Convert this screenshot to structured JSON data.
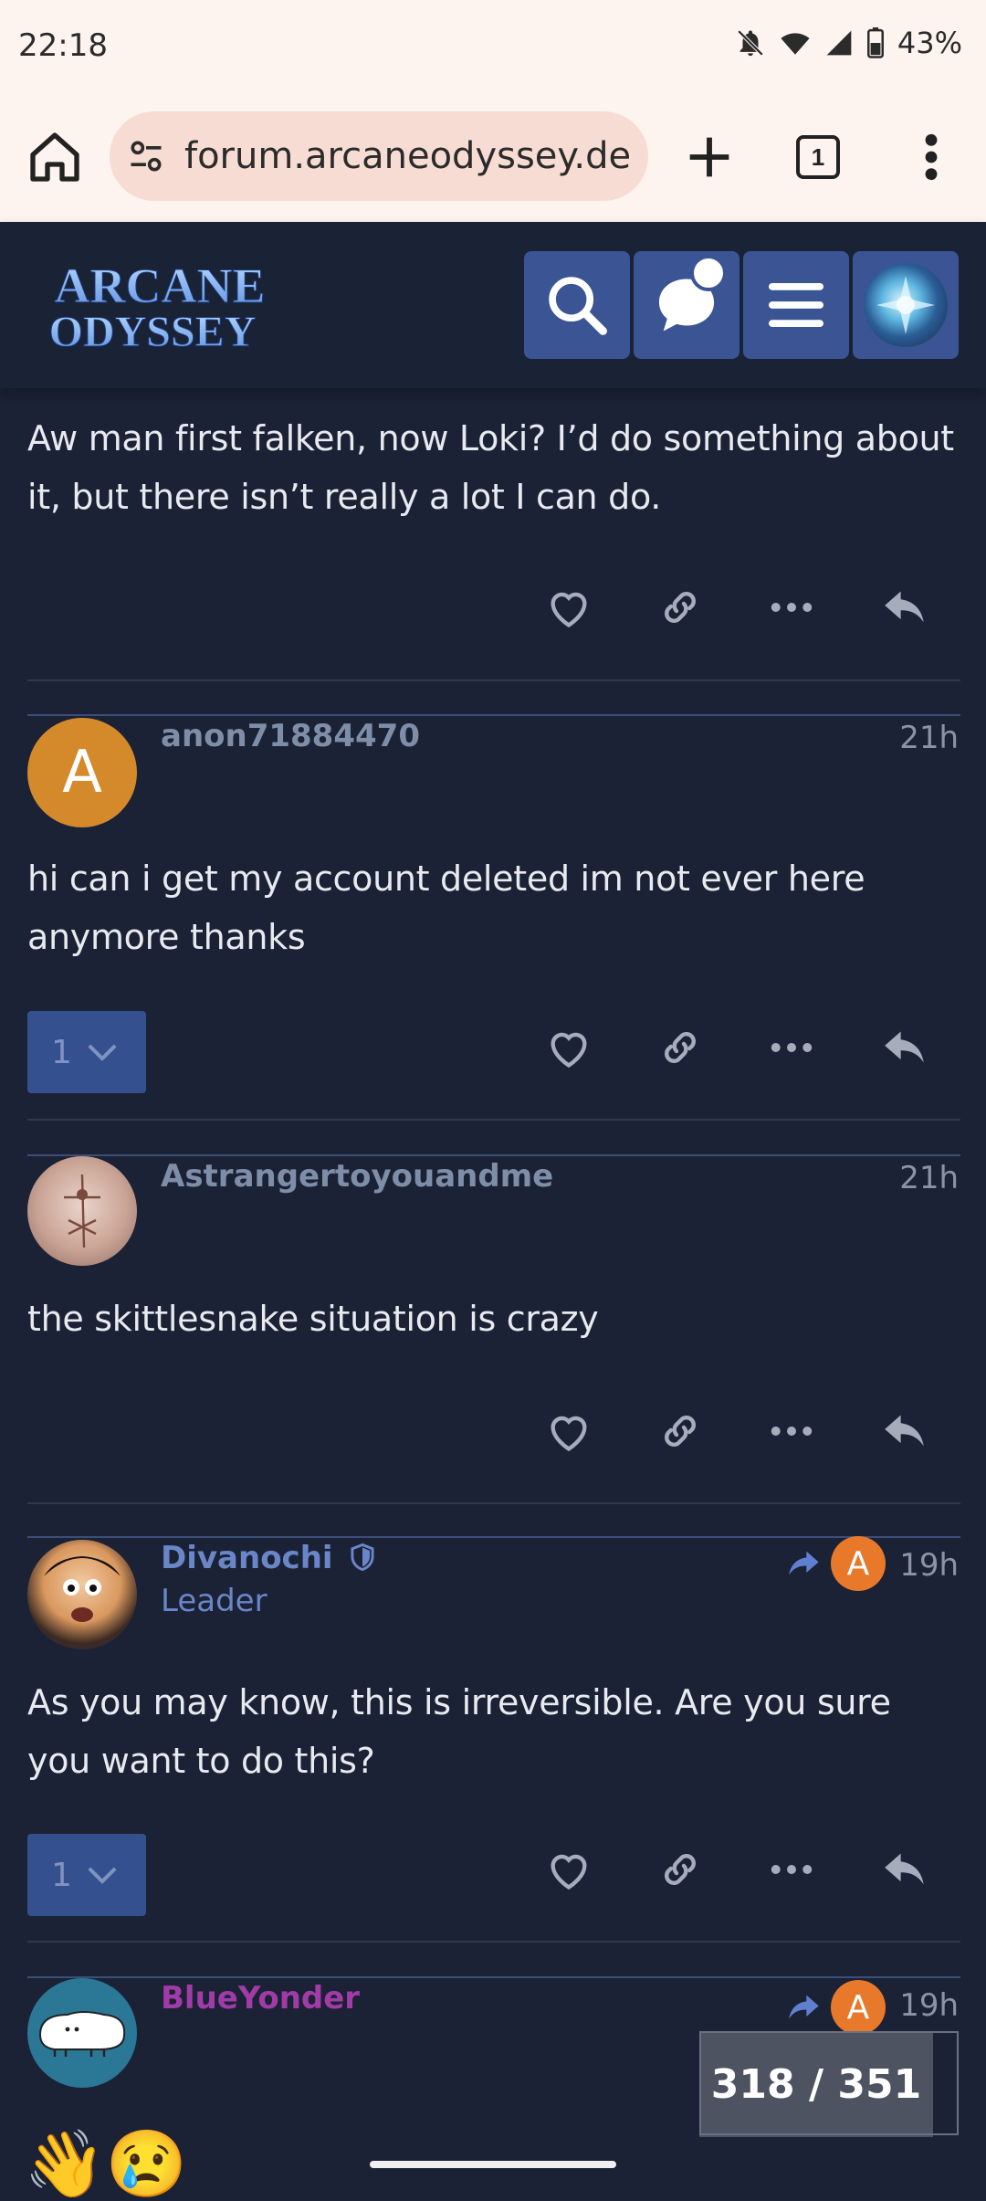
{
  "status_bar": {
    "time": "22:18",
    "battery": "43%"
  },
  "browser": {
    "url": "forum.arcaneodyssey.dev/t",
    "tab_count": "1"
  },
  "forum": {
    "logo_line1": "ARCANE",
    "logo_line2": "ODYSSEY"
  },
  "posts": [
    {
      "text": "Aw man first falken, now Loki? I’d do something about it, but there isn’t really a lot I can do."
    },
    {
      "username": "anon71884470",
      "avatar_letter": "A",
      "time": "21h",
      "text": "hi can i get my account deleted im not ever here anymore thanks",
      "replies": "1"
    },
    {
      "username": "Astrangertoyouandme",
      "time": "21h",
      "text": "the skittlesnake situation is crazy"
    },
    {
      "username": "Divanochi",
      "title": "Leader",
      "time": "19h",
      "reply_to_letter": "A",
      "text": "As you may know, this is irreversible. Are you sure you want to do this?",
      "replies": "1"
    },
    {
      "username": "BlueYonder",
      "time": "19h",
      "reply_to_letter": "A",
      "text": "👋😢"
    }
  ],
  "progress": {
    "label": "318 / 351"
  },
  "colors": {
    "background": "#1b2235",
    "accent": "#3a5494",
    "username_gray": "#7f8ea8",
    "username_leader": "#6a86c8",
    "username_purple": "#a03ba8",
    "avatar_orange": "#e8782a"
  }
}
